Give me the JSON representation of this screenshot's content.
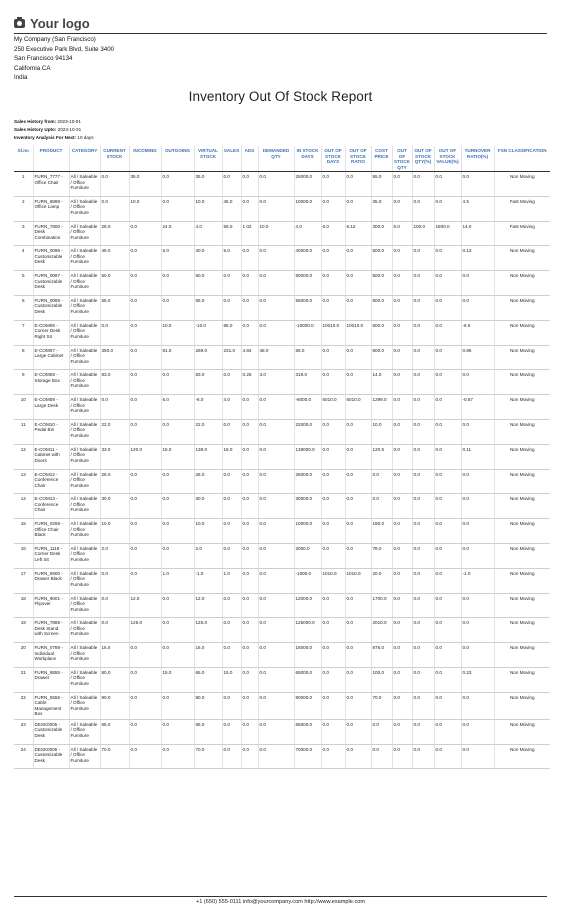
{
  "header": {
    "logo_text": "Your logo",
    "logo_icon": "camera-icon",
    "company_lines": [
      "My Company (San Francisco)",
      "250 Executive Park Blvd, Suite 3400",
      "San Francisco 94134",
      "California CA",
      "India"
    ]
  },
  "report": {
    "title": "Inventory Out Of Stock Report",
    "meta": [
      {
        "label": "Sales History from:",
        "value": "2023-10-01"
      },
      {
        "label": "Sales History Upto:",
        "value": "2023-10-31"
      },
      {
        "label": "Inventory Analysis For Next:",
        "value": "10 days"
      }
    ]
  },
  "table": {
    "columns": [
      "Sl.no",
      "PRODUCT",
      "CATEGORY",
      "CURRENT STOCK",
      "INCOMING",
      "OUTGOING",
      "VIRTUAL STOCK",
      "SALES",
      "ADS",
      "DEMANDED QTY",
      "IN STOCK DAYS",
      "OUT OF STOCK DAYS",
      "OUT OF STOCK RATIO",
      "COST PRICE",
      "OUT OF STOCK QTY",
      "OUT OF STOCK QTY(%)",
      "OUT OF STOCK VALUE(%)",
      "TURNOVER RATIO(%)",
      "FSN CLASSIFICATION"
    ],
    "category_text": "All / Saleable / Office Furniture",
    "rows": [
      [
        "1",
        "FURN_7777 - Office Chair",
        "All / Saleable / Office Furniture",
        "0.0",
        "35.0",
        "0.0",
        "35.0",
        "0.0",
        "0.0",
        "0.0",
        "25000.0",
        "0.0",
        "0.0",
        "55.0",
        "0.0",
        "0.0",
        "0.0",
        "0.0",
        "Non Moving"
      ],
      [
        "2",
        "FURN_8888 - Office Lamp",
        "All / Saleable / Office Furniture",
        "0.0",
        "10.0",
        "0.0",
        "10.0",
        "45.0",
        "0.0",
        "0.0",
        "10000.0",
        "0.0",
        "0.0",
        "35.0",
        "0.0",
        "0.0",
        "0.0",
        "4.5",
        "Fast Moving"
      ],
      [
        "3",
        "FURN_7800 - Desk Combination",
        "All / Saleable / Office Furniture",
        "28.0",
        "0.0",
        "24.0",
        "4.0",
        "56.0",
        "1.02",
        "10.0",
        "4.0",
        "6.0",
        "6.12",
        "300.0",
        "6.0",
        "100.0",
        "1800.0",
        "14.0",
        "Fast Moving"
      ],
      [
        "4",
        "FURN_0096 - Customizable Desk",
        "All / Saleable / Office Furniture",
        "45.0",
        "0.0",
        "5.0",
        "40.0",
        "5.0",
        "0.0",
        "0.0",
        "40000.0",
        "0.0",
        "0.0",
        "500.0",
        "0.0",
        "0.0",
        "0.0",
        "0.13",
        "Non Moving"
      ],
      [
        "5",
        "FURN_0097 - Customizable Desk",
        "All / Saleable / Office Furniture",
        "50.0",
        "0.0",
        "0.0",
        "50.0",
        "0.0",
        "0.0",
        "0.0",
        "50000.0",
        "0.0",
        "0.0",
        "500.0",
        "0.0",
        "0.0",
        "0.0",
        "0.0",
        "Non Moving"
      ],
      [
        "6",
        "FURN_0098 - Customizable Desk",
        "All / Saleable / Office Furniture",
        "55.0",
        "0.0",
        "0.0",
        "55.0",
        "0.0",
        "0.0",
        "0.0",
        "55000.0",
        "0.0",
        "0.0",
        "500.0",
        "0.0",
        "0.0",
        "0.0",
        "0.0",
        "Non Moving"
      ],
      [
        "7",
        "E-COM06 - Corner Desk Right Sit",
        "All / Saleable / Office Furniture",
        "0.0",
        "0.0",
        "10.0",
        "-10.0",
        "85.0",
        "0.0",
        "0.0",
        "-10000.0",
        "10010.0",
        "10010.0",
        "600.0",
        "0.0",
        "0.0",
        "0.0",
        "-8.5",
        "Non Moving"
      ],
      [
        "8",
        "E-COM07 - Large Cabinet",
        "All / Saleable / Office Furniture",
        "350.0",
        "0.0",
        "81.0",
        "269.0",
        "231.0",
        "4.84",
        "48.0",
        "56.0",
        "0.0",
        "0.0",
        "800.0",
        "0.0",
        "0.0",
        "0.0",
        "0.86",
        "Non Moving"
      ],
      [
        "9",
        "E-COM08 - Storage Box",
        "All / Saleable / Office Furniture",
        "83.0",
        "0.0",
        "0.0",
        "83.0",
        "0.0",
        "0.26",
        "3.0",
        "319.0",
        "0.0",
        "0.0",
        "14.0",
        "0.0",
        "0.0",
        "0.0",
        "0.0",
        "Non Moving"
      ],
      [
        "10",
        "E-COM09 - Large Desk",
        "All / Saleable / Office Furniture",
        "0.0",
        "0.0",
        "6.0",
        "-6.0",
        "4.0",
        "0.0",
        "0.0",
        "-6000.0",
        "6010.0",
        "6010.0",
        "1299.0",
        "0.0",
        "0.0",
        "0.0",
        "-0.67",
        "Non Moving"
      ],
      [
        "11",
        "E-COM10 - Pedal Bin",
        "All / Saleable / Office Furniture",
        "22.0",
        "0.0",
        "0.0",
        "22.0",
        "0.0",
        "0.0",
        "0.0",
        "22000.0",
        "0.0",
        "0.0",
        "10.0",
        "0.0",
        "0.0",
        "0.0",
        "0.0",
        "Non Moving"
      ],
      [
        "12",
        "E-COM11 - Cabinet with Doors",
        "All / Saleable / Office Furniture",
        "33.0",
        "120.0",
        "15.0",
        "138.0",
        "15.0",
        "0.0",
        "0.0",
        "138000.0",
        "0.0",
        "0.0",
        "120.5",
        "0.0",
        "0.0",
        "0.0",
        "0.11",
        "Non Moving"
      ],
      [
        "13",
        "E-COM12 - Conference Chair",
        "All / Saleable / Office Furniture",
        "26.0",
        "0.0",
        "0.0",
        "26.0",
        "0.0",
        "0.0",
        "0.0",
        "26000.0",
        "0.0",
        "0.0",
        "0.0",
        "0.0",
        "0.0",
        "0.0",
        "0.0",
        "Non Moving"
      ],
      [
        "14",
        "E-COM13 - Conference Chair",
        "All / Saleable / Office Furniture",
        "30.0",
        "0.0",
        "0.0",
        "30.0",
        "0.0",
        "0.0",
        "0.0",
        "30000.0",
        "0.0",
        "0.0",
        "0.0",
        "0.0",
        "0.0",
        "0.0",
        "0.0",
        "Non Moving"
      ],
      [
        "15",
        "FURN_0269 - Office Chair Black",
        "All / Saleable / Office Furniture",
        "10.0",
        "0.0",
        "0.0",
        "10.0",
        "0.0",
        "0.0",
        "0.0",
        "10000.0",
        "0.0",
        "0.0",
        "180.0",
        "0.0",
        "0.0",
        "0.0",
        "0.0",
        "Non Moving"
      ],
      [
        "16",
        "FURN_1118 - Corner Desk Left Sit",
        "All / Saleable / Office Furniture",
        "2.0",
        "0.0",
        "0.0",
        "2.0",
        "0.0",
        "0.0",
        "0.0",
        "2000.0",
        "0.0",
        "0.0",
        "78.0",
        "0.0",
        "0.0",
        "0.0",
        "0.0",
        "Non Moving"
      ],
      [
        "17",
        "FURN_8900 - Drawer Black",
        "All / Saleable / Office Furniture",
        "0.0",
        "0.0",
        "1.0",
        "-1.0",
        "1.0",
        "0.0",
        "0.0",
        "-1000.0",
        "1010.0",
        "1010.0",
        "20.0",
        "0.0",
        "0.0",
        "0.0",
        "-1.0",
        "Non Moving"
      ],
      [
        "18",
        "FURN_9001 - Flipover",
        "All / Saleable / Office Furniture",
        "0.0",
        "12.0",
        "0.0",
        "12.0",
        "0.0",
        "0.0",
        "0.0",
        "12000.0",
        "0.0",
        "0.0",
        "1700.0",
        "0.0",
        "0.0",
        "0.0",
        "0.0",
        "Non Moving"
      ],
      [
        "19",
        "FURN_7888 - Desk Stand with Screen",
        "All / Saleable / Office Furniture",
        "0.0",
        "125.0",
        "0.0",
        "125.0",
        "0.0",
        "0.0",
        "0.0",
        "125000.0",
        "0.0",
        "0.0",
        "2010.0",
        "0.0",
        "0.0",
        "0.0",
        "0.0",
        "Non Moving"
      ],
      [
        "20",
        "FURN_0789 - Individual Workplace",
        "All / Saleable / Office Furniture",
        "16.0",
        "0.0",
        "0.0",
        "16.0",
        "0.0",
        "0.0",
        "0.0",
        "16000.0",
        "0.0",
        "0.0",
        "876.0",
        "0.0",
        "0.0",
        "0.0",
        "0.0",
        "Non Moving"
      ],
      [
        "21",
        "FURN_8855 - Drawer",
        "All / Saleable / Office Furniture",
        "80.0",
        "0.0",
        "15.0",
        "65.0",
        "15.0",
        "0.0",
        "0.0",
        "65000.0",
        "0.0",
        "0.0",
        "100.0",
        "0.0",
        "0.0",
        "0.0",
        "0.23",
        "Non Moving"
      ],
      [
        "22",
        "FURN_5555 - Cable Management Box",
        "All / Saleable / Office Furniture",
        "90.0",
        "0.0",
        "0.0",
        "90.0",
        "0.0",
        "0.0",
        "0.0",
        "90000.0",
        "0.0",
        "0.0",
        "70.0",
        "0.0",
        "0.0",
        "0.0",
        "0.0",
        "Non Moving"
      ],
      [
        "23",
        "DESK0005 - Customizable Desk",
        "All / Saleable / Office Furniture",
        "65.0",
        "0.0",
        "0.0",
        "65.0",
        "0.0",
        "0.0",
        "0.0",
        "65000.0",
        "0.0",
        "0.0",
        "0.0",
        "0.0",
        "0.0",
        "0.0",
        "0.0",
        "Non Moving"
      ],
      [
        "24",
        "DESK0006 - Customizable Desk",
        "All / Saleable / Office Furniture",
        "70.0",
        "0.0",
        "0.0",
        "70.0",
        "0.0",
        "0.0",
        "0.0",
        "70000.0",
        "0.0",
        "0.0",
        "0.0",
        "0.0",
        "0.0",
        "0.0",
        "0.0",
        "Non Moving"
      ]
    ]
  },
  "footer": {
    "text": "+1 (650) 555-0111 info@yourcompany.com http://www.example.com"
  },
  "colors": {
    "header_text": "#3b6fb6",
    "rule": "#333333"
  }
}
